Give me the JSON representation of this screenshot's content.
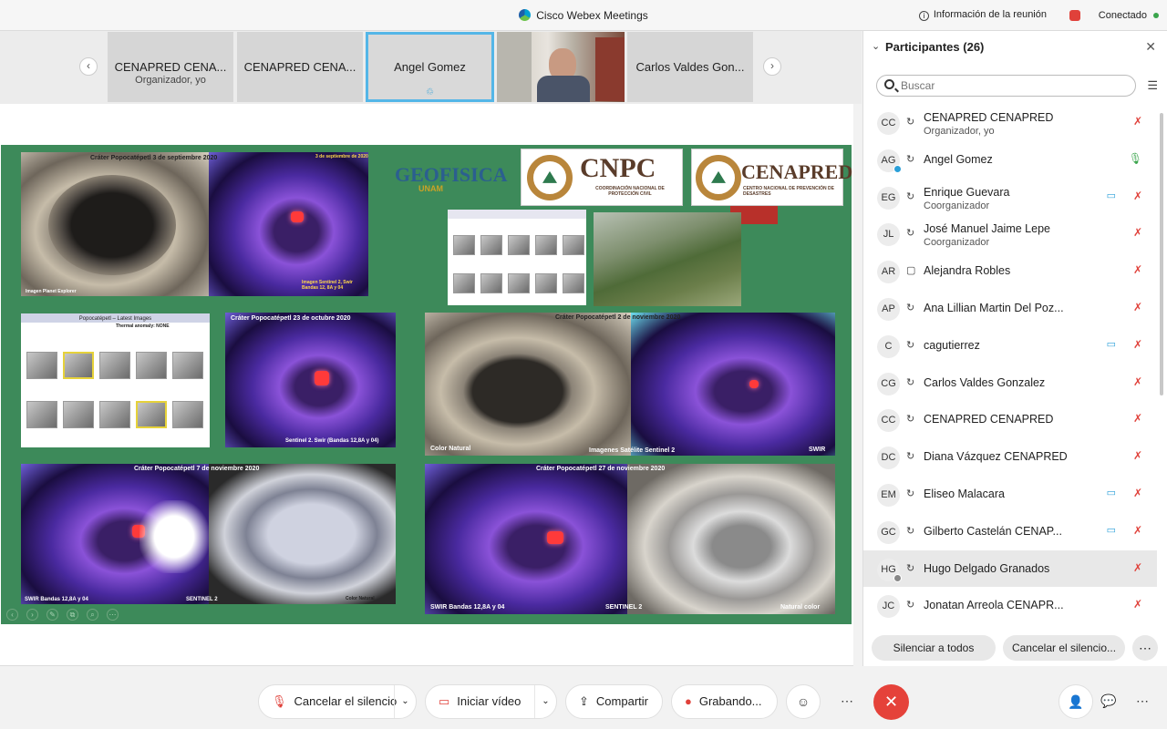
{
  "app": {
    "title": "Cisco Webex Meetings",
    "meeting_info": "Información de la reunión",
    "connection": "Conectado",
    "colors": {
      "recording": "#e0413a",
      "connected": "#3aa54c",
      "active_border": "#54b6e7",
      "end": "#e5423a"
    }
  },
  "thumbnails": [
    {
      "name": "CENAPRED CENA...",
      "sub": "Organizador, yo"
    },
    {
      "name": "CENAPRED CENA...",
      "sub": ""
    },
    {
      "name": "Angel Gomez",
      "sub": ""
    },
    {
      "name": "video",
      "sub": ""
    },
    {
      "name": "Carlos Valdes Gon...",
      "sub": ""
    }
  ],
  "slide": {
    "logos": {
      "geofisica": "GEOFISICA",
      "unam": "UNAM",
      "cnpc": "CNPC",
      "cnpc_sub": "COORDINACIÓN NACIONAL DE PROTECCIÓN CIVIL",
      "cenapred": "CENAPRED",
      "cenapred_sub": "CENTRO NACIONAL DE PREVENCIÓN DE DESASTRES"
    },
    "captions": {
      "c1": "Cráter Popocatépetl 3 de septiembre 2020",
      "c1b": "3 de septiembre de 2020",
      "c1c": "Imagen Planet Explorer",
      "c1d": "Imagen Sentinel 2, Swir Bandas 12, 8A y 04",
      "c2": "Popocatépetl – Latest Images",
      "c2b": "Thermal anomaly: NONE",
      "c3": "Cráter Popocatépetl  23 de octubre 2020",
      "c3b": "Sentinel 2. Swir (Bandas 12,8A y 04)",
      "c4": "Cráter Popocatépetl 2 de noviembre 2020",
      "c4b": "Color Natural",
      "c4c": "Imagenes Satélite Sentinel 2",
      "c4d": "SWIR",
      "c5": "Cráter Popocatépetl 7 de noviembre 2020",
      "c5b": "SWIR Bandas 12,8A y 04",
      "c5c": "SENTINEL 2",
      "c5d": "Color Natural",
      "c6": "Cráter Popocatépetl 27 de noviembre 2020",
      "c6b": "SWIR  Bandas 12,8A y 04",
      "c6c": "SENTINEL 2",
      "c6d": "Natural color"
    }
  },
  "participants": {
    "title": "Participantes (26)",
    "search_placeholder": "Buscar",
    "items": [
      {
        "initials": "CC",
        "name": "CENAPRED CENAPRED",
        "role": "Organizador, yo",
        "mic": "off",
        "cam": false
      },
      {
        "initials": "AG",
        "name": "Angel Gomez",
        "role": "",
        "mic": "on",
        "cam": false
      },
      {
        "initials": "EG",
        "name": "Enrique Guevara",
        "role": "Coorganizador",
        "mic": "off",
        "cam": true
      },
      {
        "initials": "JL",
        "name": "José Manuel Jaime Lepe",
        "role": "Coorganizador",
        "mic": "off",
        "cam": false
      },
      {
        "initials": "AR",
        "name": "Alejandra Robles",
        "role": "",
        "mic": "off",
        "cam": false
      },
      {
        "initials": "AP",
        "name": "Ana Lillian Martin Del Poz...",
        "role": "",
        "mic": "off",
        "cam": false
      },
      {
        "initials": "C",
        "name": "cagutierrez",
        "role": "",
        "mic": "off",
        "cam": true
      },
      {
        "initials": "CG",
        "name": "Carlos Valdes Gonzalez",
        "role": "",
        "mic": "off",
        "cam": false
      },
      {
        "initials": "CC",
        "name": "CENAPRED CENAPRED",
        "role": "",
        "mic": "off",
        "cam": false
      },
      {
        "initials": "DC",
        "name": "Diana Vázquez CENAPRED",
        "role": "",
        "mic": "off",
        "cam": false
      },
      {
        "initials": "EM",
        "name": "Eliseo Malacara",
        "role": "",
        "mic": "off",
        "cam": true
      },
      {
        "initials": "GC",
        "name": "Gilberto Castelán CENAP...",
        "role": "",
        "mic": "off",
        "cam": true
      },
      {
        "initials": "HG",
        "name": "Hugo Delgado Granados",
        "role": "",
        "mic": "off",
        "cam": false
      },
      {
        "initials": "JC",
        "name": "Jonatan Arreola CENAPR...",
        "role": "",
        "mic": "off",
        "cam": false
      }
    ],
    "mute_all": "Silenciar a todos",
    "unmute_all": "Cancelar el silencio..."
  },
  "controls": {
    "unmute": "Cancelar el silencio",
    "start_video": "Iniciar vídeo",
    "share": "Compartir",
    "recording": "Grabando..."
  }
}
